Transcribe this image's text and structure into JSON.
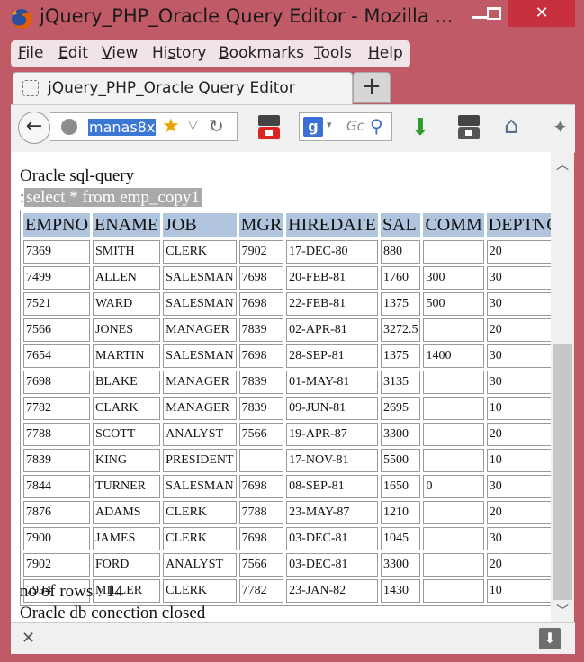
{
  "window": {
    "title": "jQuery_PHP_Oracle Query Editor - Mozilla ...",
    "minimize_glyph": "",
    "close_glyph": "✕"
  },
  "menu": [
    {
      "label": "File",
      "key": "F",
      "rest": "ile"
    },
    {
      "label": "Edit",
      "key": "E",
      "rest": "dit"
    },
    {
      "label": "View",
      "key": "V",
      "rest": "iew"
    },
    {
      "label": "History",
      "key": "s",
      "pre": "Hi",
      "rest": "tory"
    },
    {
      "label": "Bookmarks",
      "key": "B",
      "rest": "ookmarks"
    },
    {
      "label": "Tools",
      "key": "T",
      "rest": "ools"
    },
    {
      "label": "Help",
      "key": "H",
      "rest": "elp"
    }
  ],
  "tab": {
    "label": "jQuery_PHP_Oracle Query Editor",
    "new_tab_glyph": "+"
  },
  "toolbar": {
    "back_glyph": "←",
    "url": "manas8x",
    "star_glyph": "★",
    "dropdown_glyph": "▽",
    "reload_glyph": "↻",
    "search_engine_glyph": "g",
    "search_caret": "▾",
    "search_placeholder": "Gc",
    "search_glyph": "⚲",
    "download_glyph": "⬇",
    "home_glyph": "⌂",
    "ext_glyph": "✦",
    "youtube_label": "You Tube"
  },
  "content": {
    "label": "Oracle sql-query",
    "sql_prefix": ":",
    "sql": "select * from emp_copy1",
    "rows_text": "no of rows : 14",
    "closed_text": "Oracle db conection closed"
  },
  "table": {
    "columns": [
      "EMPNO",
      "ENAME",
      "JOB",
      "MGR",
      "HIREDATE",
      "SAL",
      "COMM",
      "DEPTNO"
    ],
    "rows": [
      [
        "7369",
        "SMITH",
        "CLERK",
        "7902",
        "17-DEC-80",
        "880",
        "",
        "20"
      ],
      [
        "7499",
        "ALLEN",
        "SALESMAN",
        "7698",
        "20-FEB-81",
        "1760",
        "300",
        "30"
      ],
      [
        "7521",
        "WARD",
        "SALESMAN",
        "7698",
        "22-FEB-81",
        "1375",
        "500",
        "30"
      ],
      [
        "7566",
        "JONES",
        "MANAGER",
        "7839",
        "02-APR-81",
        "3272.5",
        "",
        "20"
      ],
      [
        "7654",
        "MARTIN",
        "SALESMAN",
        "7698",
        "28-SEP-81",
        "1375",
        "1400",
        "30"
      ],
      [
        "7698",
        "BLAKE",
        "MANAGER",
        "7839",
        "01-MAY-81",
        "3135",
        "",
        "30"
      ],
      [
        "7782",
        "CLARK",
        "MANAGER",
        "7839",
        "09-JUN-81",
        "2695",
        "",
        "10"
      ],
      [
        "7788",
        "SCOTT",
        "ANALYST",
        "7566",
        "19-APR-87",
        "3300",
        "",
        "20"
      ],
      [
        "7839",
        "KING",
        "PRESIDENT",
        "",
        "17-NOV-81",
        "5500",
        "",
        "10"
      ],
      [
        "7844",
        "TURNER",
        "SALESMAN",
        "7698",
        "08-SEP-81",
        "1650",
        "0",
        "30"
      ],
      [
        "7876",
        "ADAMS",
        "CLERK",
        "7788",
        "23-MAY-87",
        "1210",
        "",
        "20"
      ],
      [
        "7900",
        "JAMES",
        "CLERK",
        "7698",
        "03-DEC-81",
        "1045",
        "",
        "30"
      ],
      [
        "7902",
        "FORD",
        "ANALYST",
        "7566",
        "03-DEC-81",
        "3300",
        "",
        "20"
      ],
      [
        "7934",
        "MILLER",
        "CLERK",
        "7782",
        "23-JAN-82",
        "1430",
        "",
        "10"
      ]
    ]
  },
  "scrollbar": {
    "up_glyph": "︿",
    "down_glyph": "﹀"
  },
  "bottombar": {
    "close_glyph": "✕",
    "download_glyph": "⬇"
  },
  "colors": {
    "window_frame": "#c05a66",
    "close_button": "#c7303c",
    "table_header_bg": "#b0c4de",
    "selection": "#3a78d4"
  }
}
